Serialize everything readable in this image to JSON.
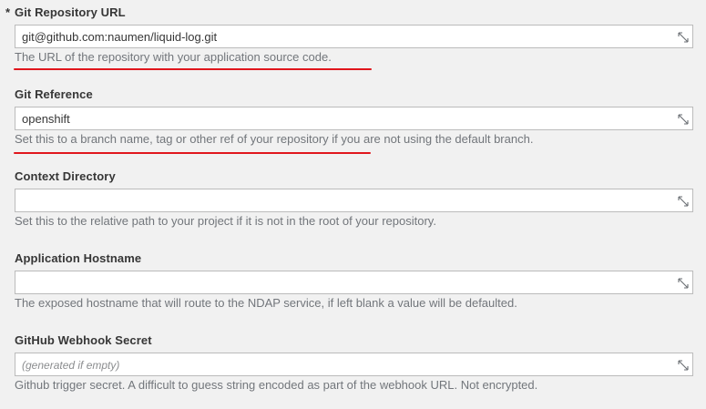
{
  "fields": [
    {
      "label": "Git Repository URL",
      "required_marker": "*",
      "value": "git@github.com:naumen/liquid-log.git",
      "placeholder": "",
      "help": "The URL of the repository with your application source code."
    },
    {
      "label": "Git Reference",
      "value": "openshift",
      "placeholder": "",
      "help": "Set this to a branch name, tag or other ref of your repository if you are not using the default branch."
    },
    {
      "label": "Context Directory",
      "value": "",
      "placeholder": "",
      "help": "Set this to the relative path to your project if it is not in the root of your repository."
    },
    {
      "label": "Application Hostname",
      "value": "",
      "placeholder": "",
      "help": "The exposed hostname that will route to the NDAP service, if left blank a value will be defaulted."
    },
    {
      "label": "GitHub Webhook Secret",
      "value": "",
      "placeholder": "(generated if empty)",
      "help": "Github trigger secret. A difficult to guess string encoded as part of the webhook URL. Not encrypted."
    }
  ],
  "icons": {
    "resize": "resize-handle-icon"
  },
  "colors": {
    "background": "#f1f1f1",
    "annotation_underline": "#e0161d",
    "help_text": "#72767b",
    "label_text": "#363636"
  }
}
